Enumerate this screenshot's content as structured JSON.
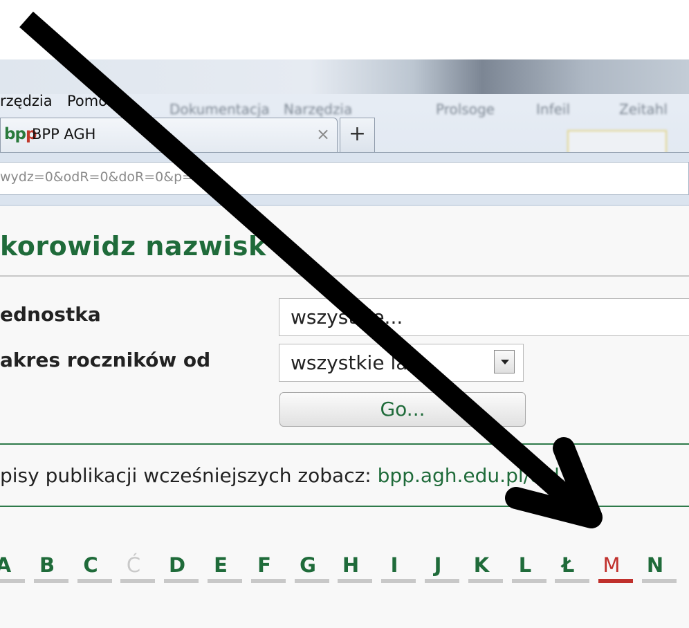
{
  "menu": {
    "items": [
      "rzędzia",
      "Pomo"
    ],
    "blurred": [
      "Narzędzia",
      "Dokumentacja",
      "Prolsoge",
      "Infeil",
      "Zeitahl"
    ]
  },
  "tab": {
    "logo": {
      "b": "b",
      "p1": "p",
      "p2": "p"
    },
    "title": "BPP AGH",
    "close": "×",
    "new_tab": "+"
  },
  "url": {
    "text": "wydz=0&odR=0&doR=0&p=M"
  },
  "page": {
    "title": "korowidz nazwisk",
    "unit_label": "ednostka",
    "unit_value": "wszystkie...",
    "range_label": "akres roczników od",
    "range_value": "wszystkie la",
    "go_button": "Go...",
    "info_prefix": "pisy publikacji wcześniejszych zobacz: ",
    "info_link": "bpp.agh.edu.pl/old",
    "info_suffix": "."
  },
  "alphabet": [
    {
      "letter": "A",
      "state": "enabled"
    },
    {
      "letter": "B",
      "state": "enabled"
    },
    {
      "letter": "C",
      "state": "enabled"
    },
    {
      "letter": "Ć",
      "state": "disabled"
    },
    {
      "letter": "D",
      "state": "enabled"
    },
    {
      "letter": "E",
      "state": "enabled"
    },
    {
      "letter": "F",
      "state": "enabled"
    },
    {
      "letter": "G",
      "state": "enabled"
    },
    {
      "letter": "H",
      "state": "enabled"
    },
    {
      "letter": "I",
      "state": "enabled"
    },
    {
      "letter": "J",
      "state": "enabled"
    },
    {
      "letter": "K",
      "state": "enabled"
    },
    {
      "letter": "L",
      "state": "enabled"
    },
    {
      "letter": "Ł",
      "state": "enabled"
    },
    {
      "letter": "M",
      "state": "active"
    },
    {
      "letter": "N",
      "state": "enabled"
    }
  ],
  "colors": {
    "brand_green": "#1f6b3a",
    "active_red": "#c0302c",
    "arrow": "#000000"
  }
}
